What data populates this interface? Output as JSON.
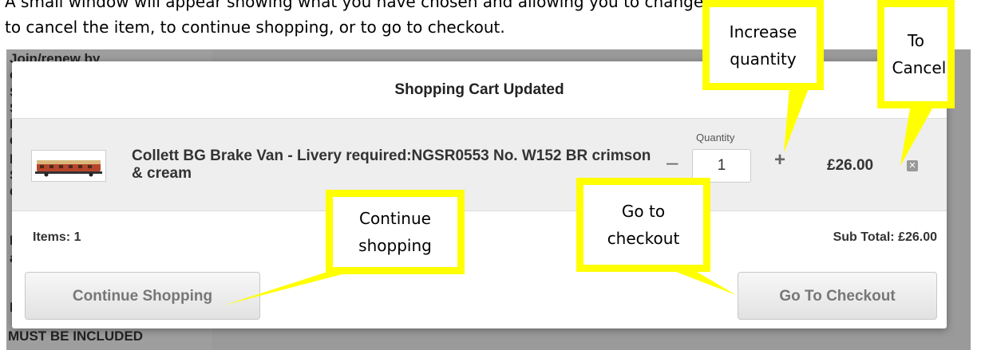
{
  "intro": {
    "line1": "A small window will appear showing what you have chosen and allowing you to change the Quantity,",
    "line2": "to cancel the item, to continue shopping, or to go to checkout."
  },
  "background": {
    "sidebar_fragments": [
      "Join/renew by",
      "c",
      "S",
      "S",
      "E",
      "d",
      "H",
      "S",
      "d",
      "M",
      "a",
      "D"
    ],
    "sidebar_bottom": "MUST BE INCLUDED"
  },
  "modal": {
    "title": "Shopping Cart Updated",
    "item": {
      "name": "Collett BG Brake Van - Livery required:NGSR0553 No. W152 BR crimson & cream",
      "quantity_label": "Quantity",
      "quantity": "1",
      "minus": "–",
      "plus": "+",
      "price": "£26.00",
      "remove_icon": "close-icon"
    },
    "items_count": "Items: 1",
    "subtotal": "Sub Total: £26.00",
    "continue_label": "Continue Shopping",
    "checkout_label": "Go To Checkout"
  },
  "callouts": {
    "increase": "Increase quantity",
    "cancel": "To Cancel",
    "continue": "Continue shopping",
    "checkout": "Go to checkout"
  },
  "colors": {
    "callout_border": "#ffff00",
    "overlay": "#9a9a9a"
  }
}
